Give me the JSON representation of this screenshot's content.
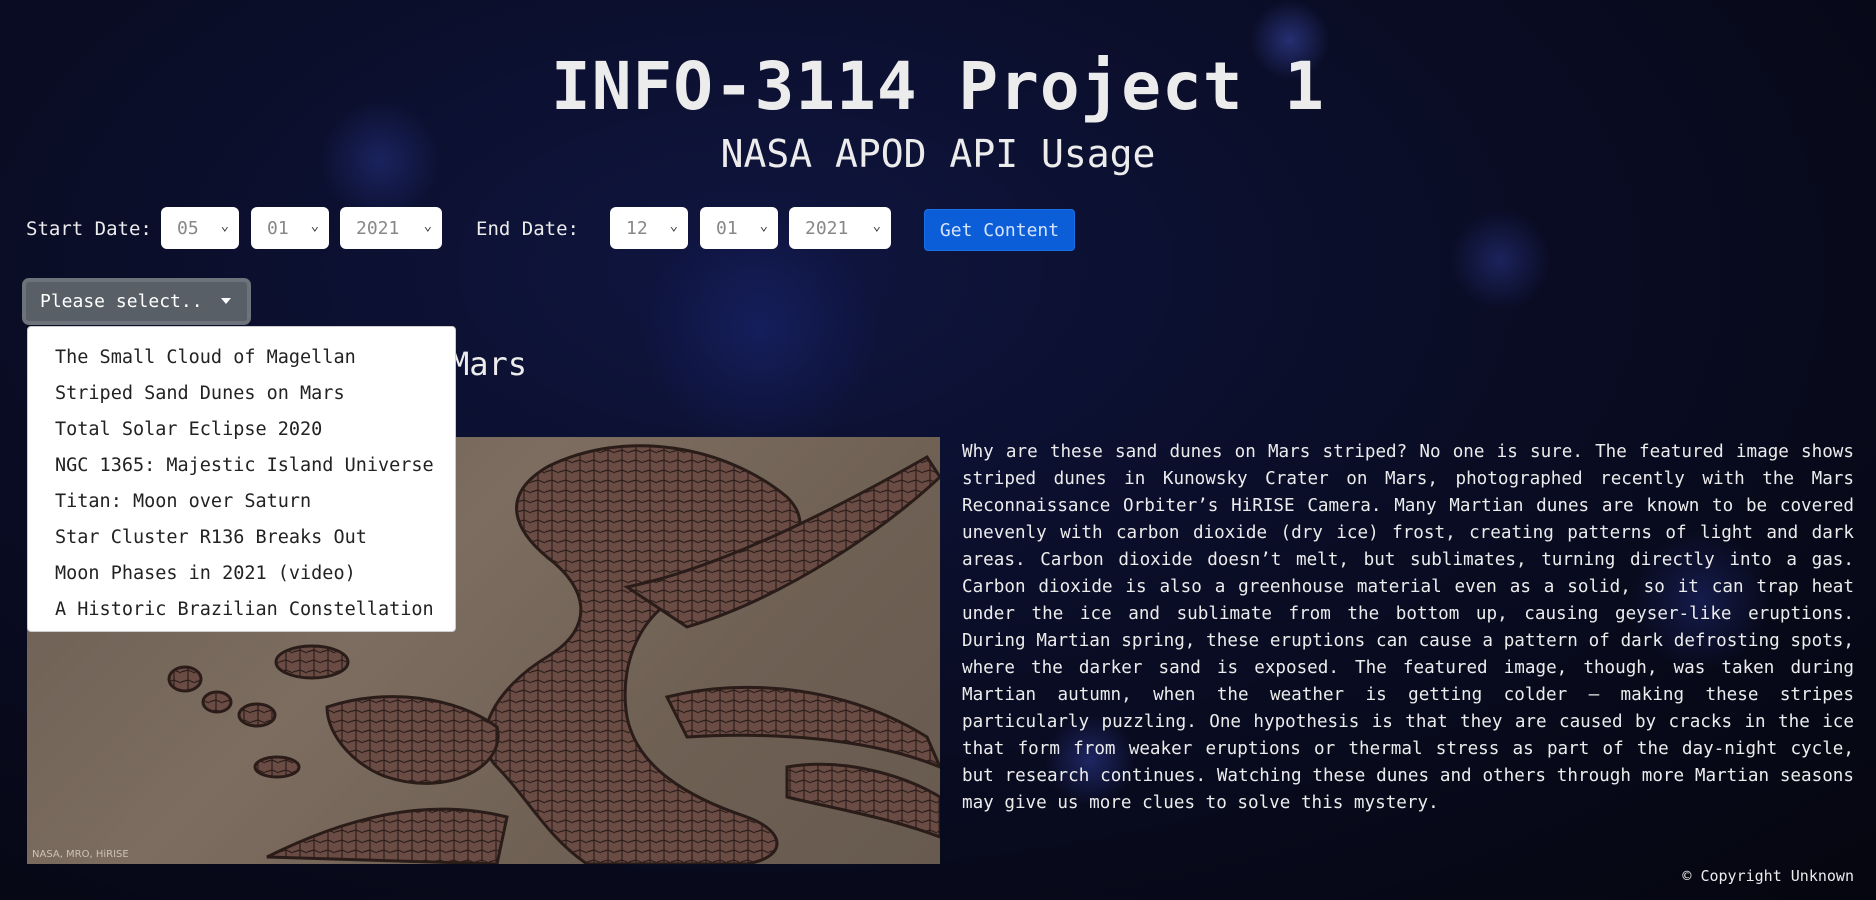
{
  "header": {
    "title": "INFO-3114 Project 1",
    "subtitle": "NASA APOD API Usage"
  },
  "controls": {
    "start_label": "Start Date:",
    "start_month": "05",
    "start_day": "01",
    "start_year": "2021",
    "end_label": "End Date:",
    "end_month": "12",
    "end_day": "01",
    "end_year": "2021",
    "get_content_label": "Get Content"
  },
  "dropdown": {
    "toggle_label": "Please select..",
    "items": [
      "The Small Cloud of Magellan",
      "Striped Sand Dunes on Mars",
      "Total Solar Eclipse 2020",
      "NGC 1365: Majestic Island Universe",
      "Titan: Moon over Saturn",
      "Star Cluster R136 Breaks Out",
      "Moon Phases in 2021 (video)",
      "A Historic Brazilian Constellation"
    ]
  },
  "content": {
    "visible_title_fragment": "Mars",
    "image_credit": "NASA, MRO, HiRISE",
    "explanation": "Why are these sand dunes on Mars striped? No one is sure. The featured image shows striped dunes in Kunowsky Crater on Mars, photographed recently with the Mars Reconnaissance Orbiter’s HiRISE Camera. Many Martian dunes are known to be covered unevenly with carbon dioxide (dry ice) frost, creating patterns of light and dark areas. Carbon dioxide doesn’t melt, but sublimates, turning directly into a gas. Carbon dioxide is also a greenhouse material even as a solid, so it can trap heat under the ice and sublimate from the bottom up, causing geyser-like eruptions. During Martian spring, these eruptions can cause a pattern of dark defrosting spots, where the darker sand is exposed. The featured image, though, was taken during Martian autumn, when the weather is getting colder – making these stripes particularly puzzling. One hypothesis is that they are caused by cracks in the ice that form from weaker eruptions or thermal stress as part of the day-night cycle, but research continues. Watching these dunes and others through more Martian seasons may give us more clues to solve this mystery.",
    "copyright": "© Copyright Unknown"
  }
}
